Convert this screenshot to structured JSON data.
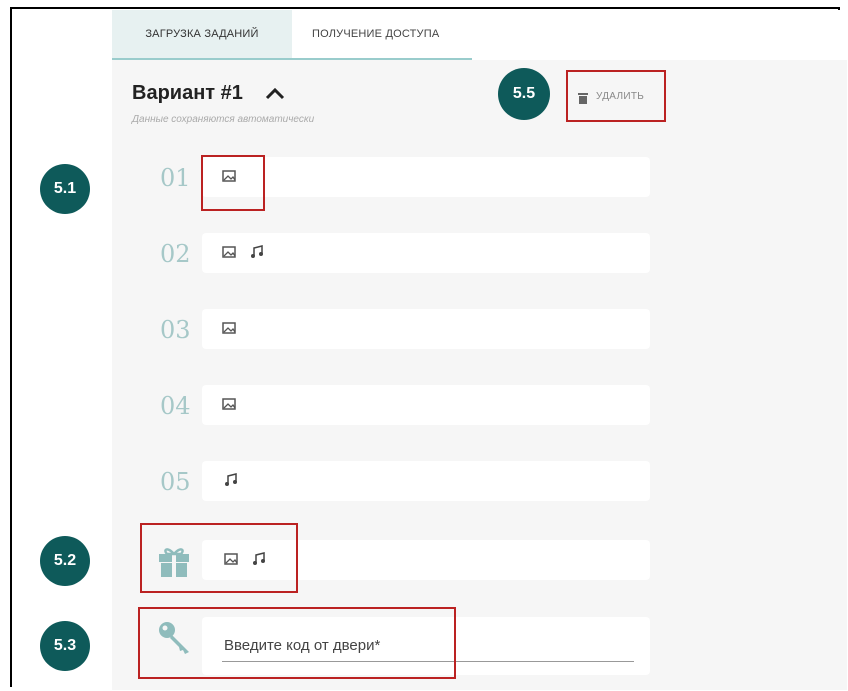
{
  "tabs": [
    {
      "label": "ЗАГРУЗКА ЗАДАНИЙ",
      "active": true
    },
    {
      "label": "ПОЛУЧЕНИЕ ДОСТУПА",
      "active": false
    }
  ],
  "variant": {
    "title": "Вариант #1",
    "autosave_note": "Данные сохраняются автоматически",
    "delete_label": "УДАЛИТЬ"
  },
  "tasks": [
    {
      "number": "01",
      "icons": [
        "image-icon"
      ]
    },
    {
      "number": "02",
      "icons": [
        "image-icon",
        "music-icon"
      ]
    },
    {
      "number": "03",
      "icons": [
        "image-icon"
      ]
    },
    {
      "number": "04",
      "icons": [
        "image-icon"
      ]
    },
    {
      "number": "05",
      "icons": [
        "music-icon"
      ]
    }
  ],
  "gift_row": {
    "icons": [
      "gift-icon",
      "image-icon",
      "music-icon"
    ]
  },
  "door_code": {
    "placeholder": "Введите код от двери*",
    "value": ""
  },
  "callouts": [
    "5.1",
    "5.2",
    "5.3",
    "5.5"
  ],
  "colors": {
    "accent": "#0e5a5a",
    "highlight": "#bb2222",
    "number": "#a6c8c8",
    "tab_active": "#e7f1f1"
  }
}
